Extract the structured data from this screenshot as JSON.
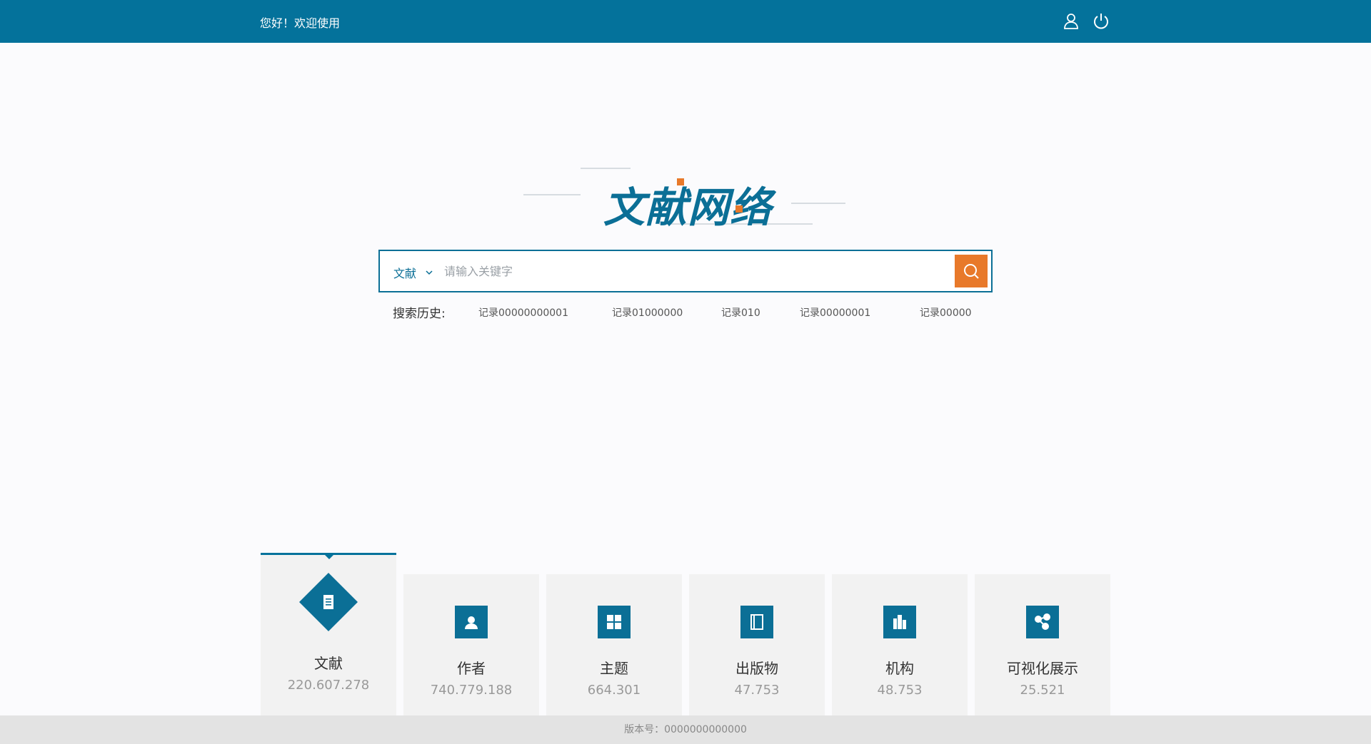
{
  "header": {
    "greeting": "您好！欢迎使用",
    "user_icon": "user-icon",
    "power_icon": "power-icon"
  },
  "logo": {
    "text": "文献网络"
  },
  "search": {
    "scope": "文献",
    "placeholder": "请输入关键字",
    "value": "",
    "button_icon": "search-icon"
  },
  "history": {
    "label": "搜索历史:",
    "items": [
      "记录00000000001",
      "记录01000000",
      "记录010",
      "记录00000001",
      "记录00000"
    ]
  },
  "cards": [
    {
      "title": "文献",
      "count": "220.607.278",
      "icon": "document-icon",
      "active": true
    },
    {
      "title": "作者",
      "count": "740.779.188",
      "icon": "author-icon",
      "active": false
    },
    {
      "title": "主题",
      "count": "664.301",
      "icon": "grid-icon",
      "active": false
    },
    {
      "title": "出版物",
      "count": "47.753",
      "icon": "book-icon",
      "active": false
    },
    {
      "title": "机构",
      "count": "48.753",
      "icon": "building-icon",
      "active": false
    },
    {
      "title": "可视化展示",
      "count": "25.521",
      "icon": "share-icon",
      "active": false
    }
  ],
  "footer": {
    "version": "版本号：0000000000000"
  },
  "colors": {
    "primary": "#04729b",
    "accent": "#e8792a",
    "card_bg": "#f2f2f2",
    "footer_bg": "#e3e3e3"
  }
}
